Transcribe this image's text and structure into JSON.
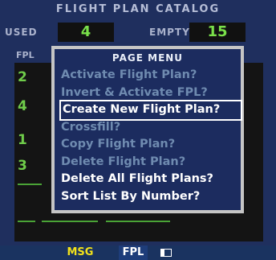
{
  "page_title": "FLIGHT PLAN CATALOG",
  "counts": {
    "used_label": "USED",
    "used_value": "4",
    "empty_label": "EMPTY",
    "empty_value": "15"
  },
  "list": {
    "column_label": "FPL",
    "visible_numbers": [
      "2",
      "4",
      "1",
      "3"
    ]
  },
  "menu": {
    "title": "PAGE MENU",
    "items": [
      {
        "label": "Activate Flight Plan?",
        "state": "disabled"
      },
      {
        "label": "Invert & Activate FPL?",
        "state": "disabled"
      },
      {
        "label": "Create New Flight Plan?",
        "state": "selected"
      },
      {
        "label": "Crossfill?",
        "state": "disabled"
      },
      {
        "label": "Copy Flight Plan?",
        "state": "disabled"
      },
      {
        "label": "Delete Flight Plan?",
        "state": "disabled"
      },
      {
        "label": "Delete All Flight Plans?",
        "state": "enabled"
      },
      {
        "label": "Sort List By Number?",
        "state": "enabled"
      }
    ]
  },
  "status_bar": {
    "msg_label": "MSG",
    "mode_label": "FPL"
  },
  "colors": {
    "background": "#1f2f5e",
    "list_green": "#6fcc4a",
    "disabled_text": "#6f8bb0",
    "msg_yellow": "#f3e21a"
  }
}
